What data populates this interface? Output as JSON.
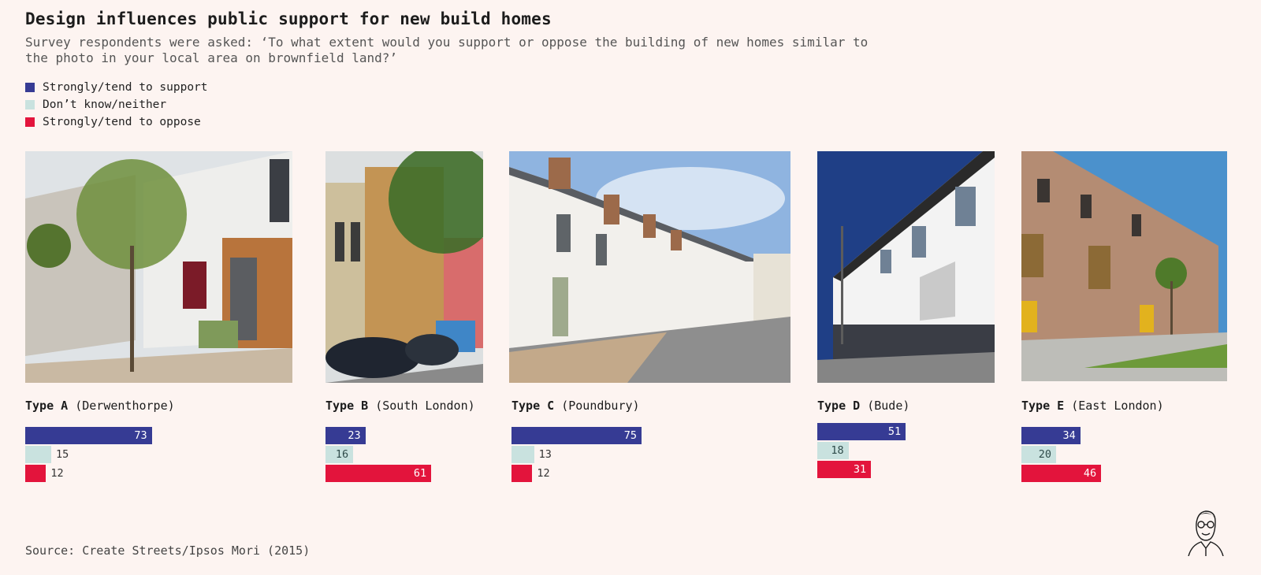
{
  "title": "Design influences public support for new build homes",
  "subtitle": "Survey respondents were asked: ‘To what extent would you support or oppose the building of new homes similar to the photo in your local area on brownfield land?’",
  "legend": [
    {
      "label": "Strongly/tend to support",
      "color": "#363b94"
    },
    {
      "label": "Don’t know/neither",
      "color": "#c9e2df"
    },
    {
      "label": "Strongly/tend to oppose",
      "color": "#e3143c"
    }
  ],
  "source": "Source: Create Streets/Ipsos Mori (2015)",
  "chart_data": {
    "type": "bar",
    "orientation": "horizontal",
    "categories": [
      "Type A (Derwenthorpe)",
      "Type B (South London)",
      "Type C (Poundbury)",
      "Type D (Bude)",
      "Type E (East London)"
    ],
    "panels": [
      {
        "type_label": "Type A",
        "place": "(Derwenthorpe)",
        "photo": "brick-and-white-terrace-photo"
      },
      {
        "type_label": "Type B",
        "place": "(South London)",
        "photo": "timber-clad-flats-photo"
      },
      {
        "type_label": "Type C",
        "place": "(Poundbury)",
        "photo": "white-georgian-terrace-photo"
      },
      {
        "type_label": "Type D",
        "place": "(Bude)",
        "photo": "white-modern-terrace-photo"
      },
      {
        "type_label": "Type E",
        "place": "(East London)",
        "photo": "brick-townhouses-photo"
      }
    ],
    "series": [
      {
        "name": "Strongly/tend to support",
        "color": "#363b94",
        "values": [
          73,
          23,
          75,
          51,
          34
        ]
      },
      {
        "name": "Don’t know/neither",
        "color": "#c9e2df",
        "values": [
          15,
          16,
          13,
          18,
          20
        ]
      },
      {
        "name": "Strongly/tend to oppose",
        "color": "#e3143c",
        "values": [
          12,
          61,
          12,
          31,
          46
        ]
      }
    ],
    "xlim": [
      0,
      100
    ],
    "legend_position": "top-left"
  }
}
